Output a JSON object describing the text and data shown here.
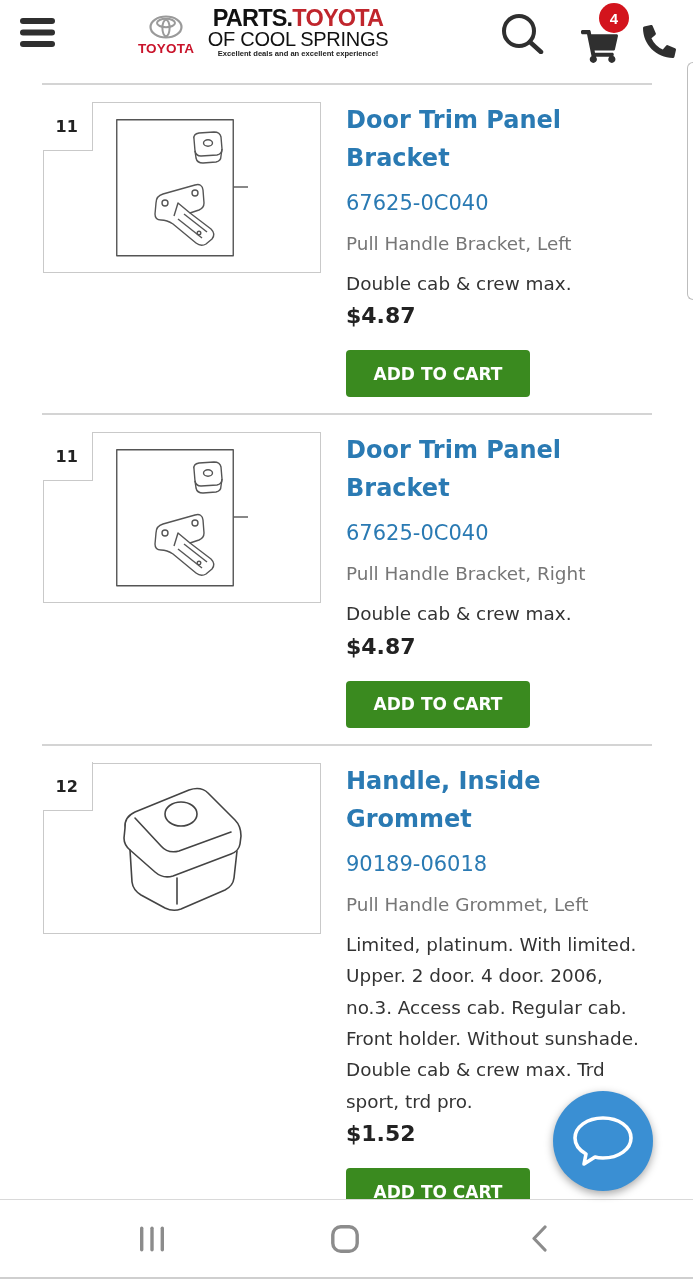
{
  "header": {
    "brand": {
      "emblem_label": "TOYOTA",
      "title_dark": "PARTS.",
      "title_red": "TOYOTA",
      "subtitle": "OF COOL SPRINGS",
      "tagline": "Excellent deals and an excellent experience!"
    },
    "cart_count": "4"
  },
  "parts": [
    {
      "kind": "bracket",
      "callout": "11",
      "title": "Door Trim Panel Bracket",
      "part_number": "67625-0C040",
      "description": "Pull Handle Bracket, Left",
      "notes": "Double cab & crew max.",
      "price": "$4.87",
      "button": "ADD TO CART"
    },
    {
      "kind": "bracket",
      "callout": "11",
      "title": "Door Trim Panel Bracket",
      "part_number": "67625-0C040",
      "description": "Pull Handle Bracket, Right",
      "notes": "Double cab & crew max.",
      "price": "$4.87",
      "button": "ADD TO CART"
    },
    {
      "kind": "grommet",
      "callout": "12",
      "title": "Handle, Inside Grommet",
      "part_number": "90189-06018",
      "description": "Pull Handle Grommet, Left",
      "notes": "Limited, platinum. With limited. Upper. 2 door. 4 door. 2006, no.3. Access cab. Regular cab. Front holder. Without sunshade. Double cab & crew max. Trd sport, trd pro.",
      "price": "$1.52",
      "button": "ADD TO CART"
    }
  ]
}
